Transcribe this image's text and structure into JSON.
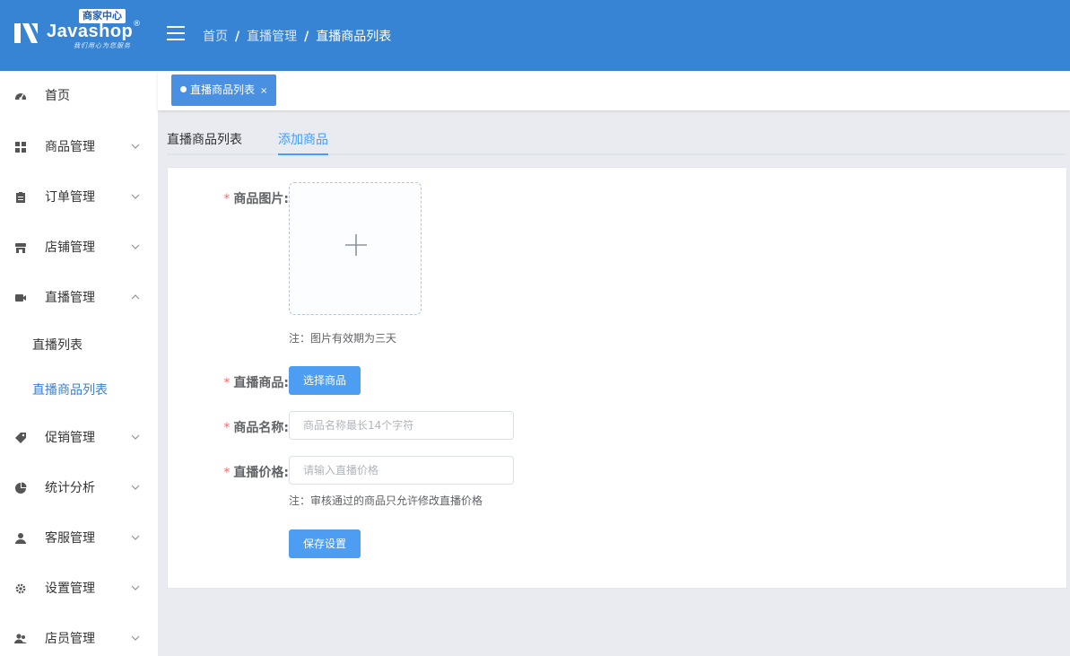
{
  "header": {
    "logo": {
      "badge": "商家中心",
      "name": "Javashop",
      "reg": "®",
      "slogan": "我们用心为您服务"
    },
    "breadcrumb": [
      "首页",
      "直播管理",
      "直播商品列表"
    ],
    "sep": "/"
  },
  "sidebar": {
    "items": [
      {
        "label": "首页",
        "icon": "dashboard-icon"
      },
      {
        "label": "商品管理",
        "icon": "goods-icon"
      },
      {
        "label": "订单管理",
        "icon": "order-icon"
      },
      {
        "label": "店铺管理",
        "icon": "shop-icon"
      },
      {
        "label": "直播管理",
        "icon": "video-icon"
      },
      {
        "label": "促销管理",
        "icon": "tag-icon"
      },
      {
        "label": "统计分析",
        "icon": "pie-chart-icon"
      },
      {
        "label": "客服管理",
        "icon": "user-icon"
      },
      {
        "label": "设置管理",
        "icon": "gear-icon"
      },
      {
        "label": "店员管理",
        "icon": "users-icon"
      }
    ],
    "live_sub": [
      "直播列表",
      "直播商品列表"
    ]
  },
  "tags": {
    "active": "直播商品列表",
    "close": "×"
  },
  "tabs": [
    "直播商品列表",
    "添加商品"
  ],
  "form": {
    "image_label": "商品图片:",
    "image_note": "注：图片有效期为三天",
    "goods_label": "直播商品:",
    "select_button": "选择商品",
    "name_label": "商品名称:",
    "name_placeholder": "商品名称最长14个字符",
    "price_label": "直播价格:",
    "price_placeholder": "请输入直播价格",
    "price_note": "注：审核通过的商品只允许修改直播价格",
    "save_button": "保存设置",
    "required_mark": "*"
  },
  "colors": {
    "header": "#3884d4",
    "accent": "#409eff",
    "required": "#f56c6c"
  }
}
